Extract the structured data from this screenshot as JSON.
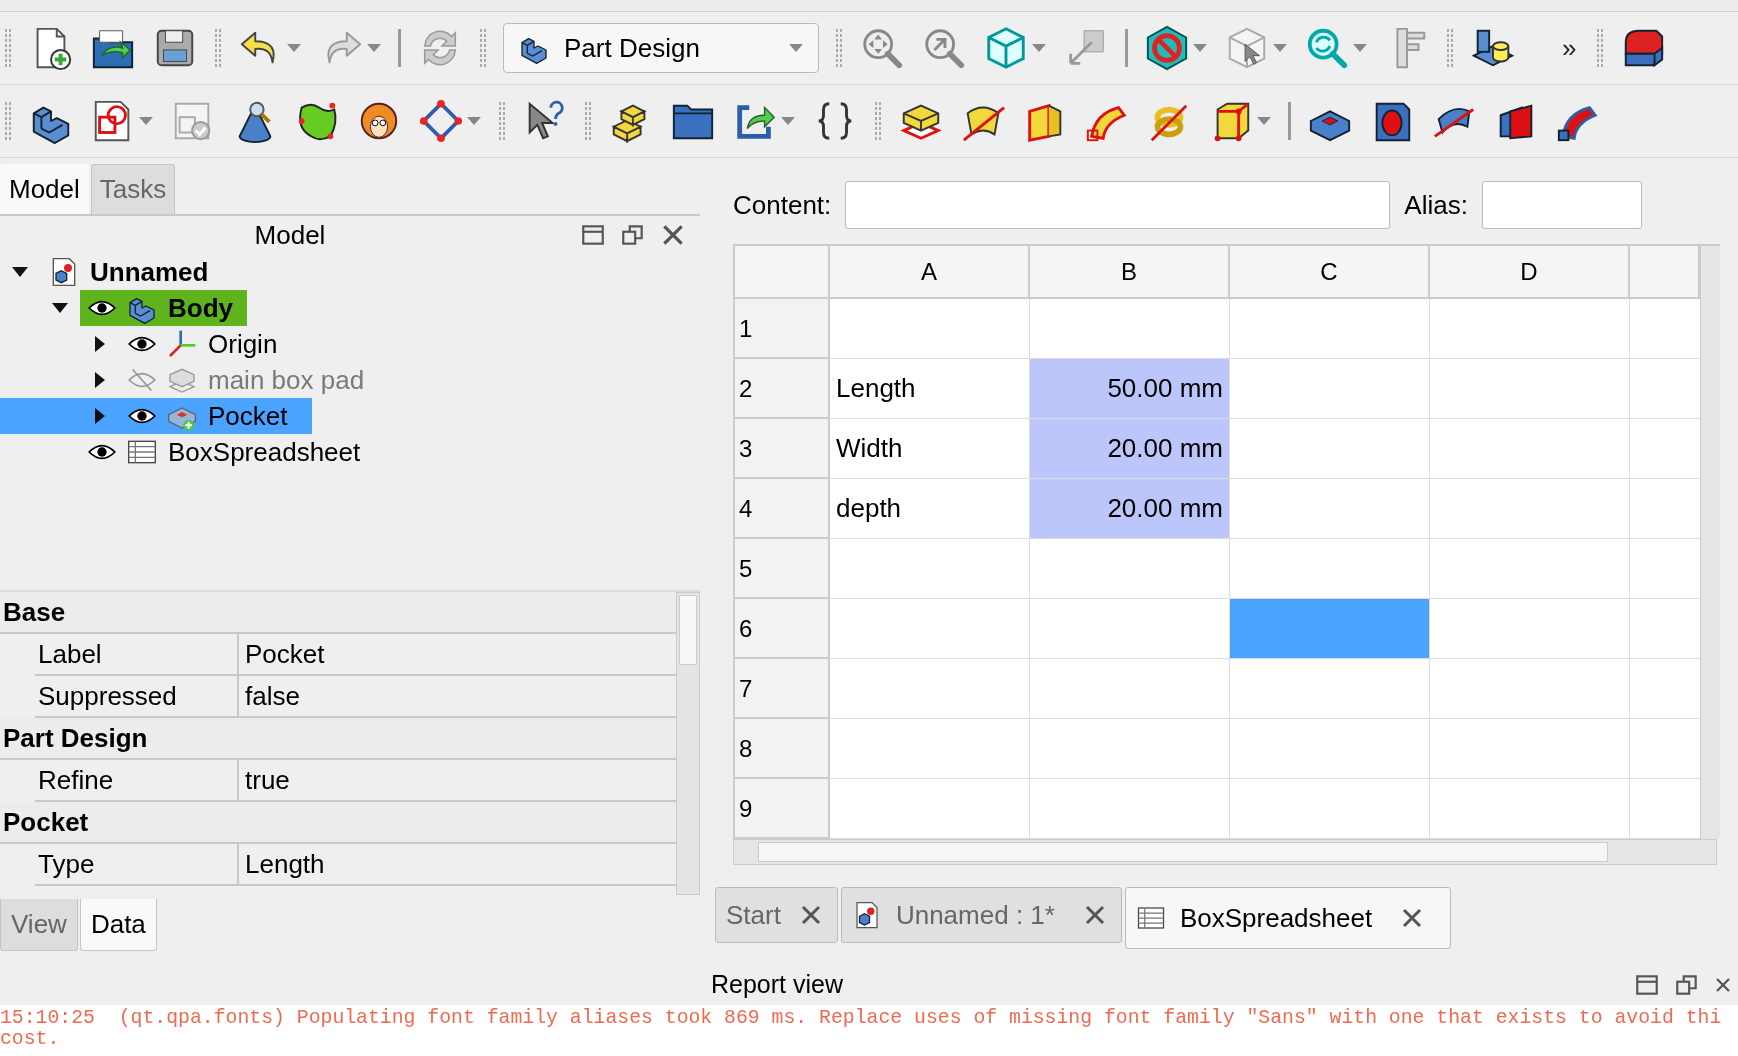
{
  "toolbar": {
    "workbench": "Part Design",
    "overflow": "»"
  },
  "combo_view": {
    "tabs": [
      {
        "label": "Model",
        "selected": true
      },
      {
        "label": "Tasks",
        "selected": false
      }
    ],
    "title": "Model",
    "tree": [
      {
        "label": "Unnamed",
        "kind": "document",
        "expanded": true,
        "selected": false,
        "children": [
          {
            "label": "Body",
            "kind": "body",
            "expanded": true,
            "visible": true,
            "active": true,
            "selected": false,
            "children": [
              {
                "label": "Origin",
                "kind": "origin",
                "expanded": false,
                "visible": true,
                "active": false,
                "selected": false
              },
              {
                "label": "main box pad",
                "kind": "pad",
                "expanded": false,
                "visible": false,
                "active": false,
                "selected": false
              },
              {
                "label": "Pocket",
                "kind": "pocket",
                "expanded": false,
                "visible": true,
                "active": false,
                "selected": true
              }
            ]
          },
          {
            "label": "BoxSpreadsheet",
            "kind": "spreadsheet",
            "visible": true,
            "active": false,
            "selected": false
          }
        ]
      }
    ],
    "properties": [
      {
        "group": "Base",
        "rows": [
          {
            "name": "Label",
            "value": "Pocket"
          },
          {
            "name": "Suppressed",
            "value": "false"
          }
        ]
      },
      {
        "group": "Part Design",
        "rows": [
          {
            "name": "Refine",
            "value": "true"
          }
        ]
      },
      {
        "group": "Pocket",
        "rows": [
          {
            "name": "Type",
            "value": "Length"
          }
        ]
      }
    ],
    "bottom_tabs": [
      {
        "label": "View",
        "selected": false
      },
      {
        "label": "Data",
        "selected": true
      }
    ]
  },
  "spreadsheet": {
    "content_label": "Content:",
    "alias_label": "Alias:",
    "columns": [
      "A",
      "B",
      "C",
      "D"
    ],
    "rows": [
      {
        "header": "1",
        "cells": [
          {
            "highlighted": false,
            "selected": false
          },
          {
            "highlighted": false,
            "selected": false
          },
          {
            "highlighted": false,
            "selected": false
          },
          {
            "highlighted": false,
            "selected": false
          }
        ]
      },
      {
        "header": "2",
        "cells": [
          {
            "text": "Length",
            "highlighted": false,
            "selected": false
          },
          {
            "text": "50.00 mm",
            "highlighted": true,
            "selected": false
          },
          {
            "highlighted": false,
            "selected": false
          },
          {
            "highlighted": false,
            "selected": false
          }
        ]
      },
      {
        "header": "3",
        "cells": [
          {
            "text": "Width",
            "highlighted": false,
            "selected": false
          },
          {
            "text": "20.00 mm",
            "highlighted": true,
            "selected": false
          },
          {
            "highlighted": false,
            "selected": false
          },
          {
            "highlighted": false,
            "selected": false
          }
        ]
      },
      {
        "header": "4",
        "cells": [
          {
            "text": "depth",
            "highlighted": false,
            "selected": false
          },
          {
            "text": "20.00 mm",
            "highlighted": true,
            "selected": false
          },
          {
            "highlighted": false,
            "selected": false
          },
          {
            "highlighted": false,
            "selected": false
          }
        ]
      },
      {
        "header": "5",
        "cells": [
          {
            "highlighted": false,
            "selected": false
          },
          {
            "highlighted": false,
            "selected": false
          },
          {
            "highlighted": false,
            "selected": false
          },
          {
            "highlighted": false,
            "selected": false
          }
        ]
      },
      {
        "header": "6",
        "cells": [
          {
            "highlighted": false,
            "selected": false
          },
          {
            "highlighted": false,
            "selected": false
          },
          {
            "highlighted": false,
            "selected": true
          },
          {
            "highlighted": false,
            "selected": false
          }
        ]
      },
      {
        "header": "7",
        "cells": [
          {
            "highlighted": false,
            "selected": false
          },
          {
            "highlighted": false,
            "selected": false
          },
          {
            "highlighted": false,
            "selected": false
          },
          {
            "highlighted": false,
            "selected": false
          }
        ]
      },
      {
        "header": "8",
        "cells": [
          {
            "highlighted": false,
            "selected": false
          },
          {
            "highlighted": false,
            "selected": false
          },
          {
            "highlighted": false,
            "selected": false
          },
          {
            "highlighted": false,
            "selected": false
          }
        ]
      },
      {
        "header": "9",
        "cells": [
          {
            "highlighted": false,
            "selected": false
          },
          {
            "highlighted": false,
            "selected": false
          },
          {
            "highlighted": false,
            "selected": false
          },
          {
            "highlighted": false,
            "selected": false
          }
        ]
      }
    ]
  },
  "document_tabs": [
    {
      "label": "Start",
      "kind": "start",
      "selected": false
    },
    {
      "label": "Unnamed : 1*",
      "kind": "document",
      "selected": false
    },
    {
      "label": "BoxSpreadsheet",
      "kind": "spreadsheet",
      "selected": true
    }
  ],
  "report_view": {
    "title": "Report view",
    "lines": [
      "15:10:25  (qt.qpa.fonts) Populating font family aliases took 869 ms. Replace uses of missing font family \"Sans\" with one that exists to avoid thi",
      "cost."
    ]
  }
}
